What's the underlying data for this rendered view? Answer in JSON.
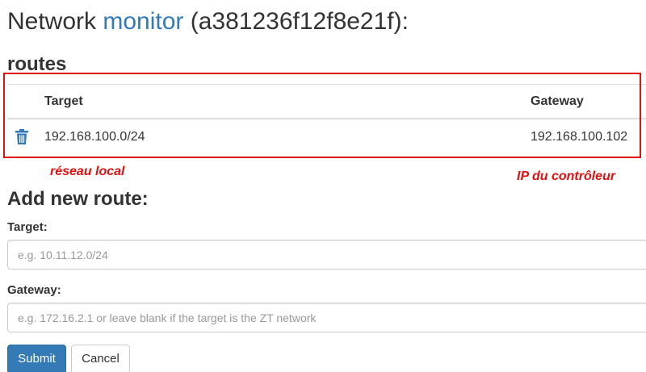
{
  "header": {
    "title_prefix": "Network ",
    "title_link": "monitor",
    "title_suffix": " (a381236f12f8e21f):"
  },
  "routes": {
    "heading": "routes",
    "columns": [
      "Target",
      "Gateway"
    ],
    "rows": [
      {
        "target": "192.168.100.0/24",
        "gateway": "192.168.100.102",
        "delete_icon": "trash-icon"
      }
    ]
  },
  "annotations": {
    "left": "réseau local",
    "right": "IP du contrôleur",
    "color": "#e01010"
  },
  "add_route": {
    "heading": "Add new route:",
    "target_label": "Target:",
    "target_placeholder": "e.g. 10.11.12.0/24",
    "target_value": "",
    "gateway_label": "Gateway:",
    "gateway_placeholder": "e.g. 172.16.2.1 or leave blank if the target is the ZT network",
    "gateway_value": "",
    "submit_label": "Submit",
    "cancel_label": "Cancel"
  },
  "colors": {
    "link": "#337ab7",
    "primary_button": "#337ab7",
    "text": "#333333"
  }
}
